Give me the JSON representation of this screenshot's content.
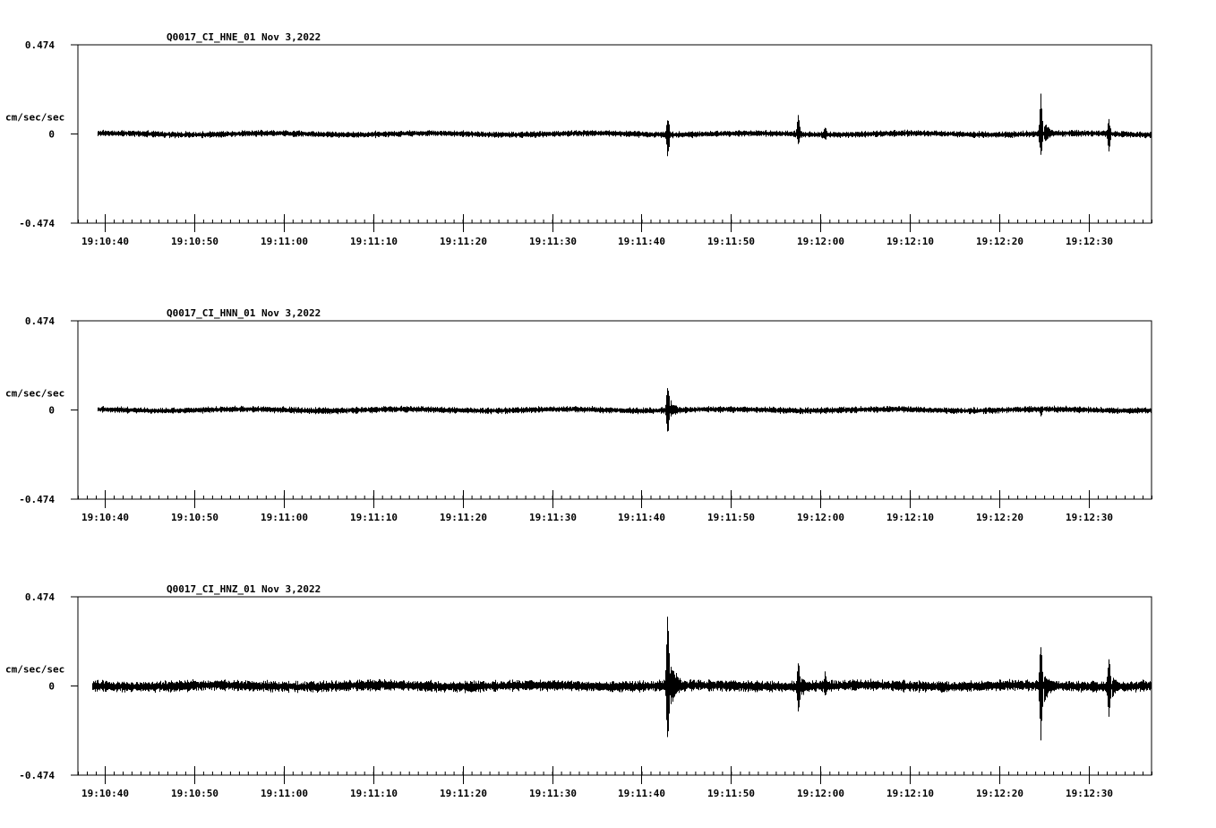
{
  "chart_data": [
    {
      "type": "line",
      "title": "Q0017_CI_HNE_01  Nov 3,2022",
      "ylabel": "cm/sec/sec",
      "ylim": [
        -0.474,
        0.474
      ],
      "yticks": [
        "0.474",
        "0",
        "-0.474"
      ],
      "xticks": [
        "19:10:40",
        "19:10:50",
        "19:11:00",
        "19:11:10",
        "19:11:20",
        "19:11:30",
        "19:11:40",
        "19:11:50",
        "19:12:00",
        "19:12:10",
        "19:12:20",
        "19:12:30"
      ],
      "x_start_s": 37.0,
      "x_end_s": 157.0,
      "trace_start_s": 39.2,
      "noise_amplitude": 0.02,
      "events": [
        {
          "t": 102.9,
          "pos": 0.115,
          "neg": -0.145
        },
        {
          "t": 117.5,
          "pos": 0.12,
          "neg": -0.065
        },
        {
          "t": 120.5,
          "pos": 0.05,
          "neg": -0.04
        },
        {
          "t": 144.6,
          "pos": 0.23,
          "neg": -0.155
        },
        {
          "t": 152.2,
          "pos": 0.09,
          "neg": -0.1
        }
      ]
    },
    {
      "type": "line",
      "title": "Q0017_CI_HNN_01  Nov 3,2022",
      "ylabel": "cm/sec/sec",
      "ylim": [
        -0.474,
        0.474
      ],
      "yticks": [
        "0.474",
        "0",
        "-0.474"
      ],
      "xticks": [
        "19:10:40",
        "19:10:50",
        "19:11:00",
        "19:11:10",
        "19:11:20",
        "19:11:30",
        "19:11:40",
        "19:11:50",
        "19:12:00",
        "19:12:10",
        "19:12:20",
        "19:12:30"
      ],
      "x_start_s": 37.0,
      "x_end_s": 157.0,
      "trace_start_s": 39.2,
      "noise_amplitude": 0.02,
      "events": [
        {
          "t": 102.9,
          "pos": 0.16,
          "neg": -0.155
        },
        {
          "t": 144.6,
          "pos": 0.02,
          "neg": -0.04
        }
      ]
    },
    {
      "type": "line",
      "title": "Q0017_CI_HNZ_01  Nov 3,2022",
      "ylabel": "cm/sec/sec",
      "ylim": [
        -0.474,
        0.474
      ],
      "yticks": [
        "0.474",
        "0",
        "-0.474"
      ],
      "xticks": [
        "19:10:40",
        "19:10:50",
        "19:11:00",
        "19:11:10",
        "19:11:20",
        "19:11:30",
        "19:11:40",
        "19:11:50",
        "19:12:00",
        "19:12:10",
        "19:12:20",
        "19:12:30"
      ],
      "x_start_s": 37.0,
      "x_end_s": 157.0,
      "trace_start_s": 38.6,
      "noise_amplitude": 0.035,
      "events": [
        {
          "t": 102.9,
          "pos": 0.474,
          "neg": -0.38
        },
        {
          "t": 117.5,
          "pos": 0.155,
          "neg": -0.195
        },
        {
          "t": 120.5,
          "pos": 0.09,
          "neg": -0.07
        },
        {
          "t": 144.6,
          "pos": 0.27,
          "neg": -0.32
        },
        {
          "t": 152.2,
          "pos": 0.175,
          "neg": -0.205
        }
      ]
    }
  ]
}
